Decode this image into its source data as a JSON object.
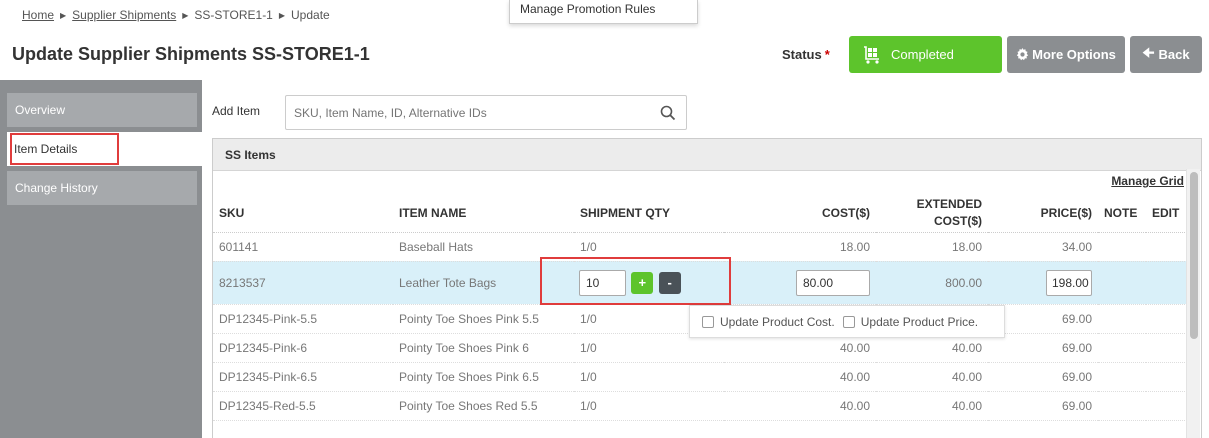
{
  "breadcrumb": {
    "home": "Home",
    "supplier_shipments": "Supplier Shipments",
    "record": "SS-STORE1-1",
    "current": "Update"
  },
  "popup_menu": {
    "item": "Manage Promotion Rules"
  },
  "page": {
    "title": "Update Supplier Shipments SS-STORE1-1"
  },
  "status": {
    "label": "Status",
    "required_mark": "*",
    "value": "Completed",
    "color": "#5dc42c"
  },
  "buttons": {
    "more_options": "More Options",
    "back": "Back"
  },
  "sidebar": {
    "items": [
      {
        "label": "Overview"
      },
      {
        "label": "Item Details"
      },
      {
        "label": "Change History"
      }
    ]
  },
  "add_item": {
    "label": "Add Item",
    "placeholder": "SKU, Item Name, ID, Alternative IDs"
  },
  "panel": {
    "title": "SS Items",
    "manage_grid": "Manage Grid"
  },
  "table": {
    "headers": {
      "sku": "SKU",
      "item_name": "ITEM NAME",
      "shipment_qty": "SHIPMENT QTY",
      "cost": "COST($)",
      "extended_cost_1": "EXTENDED",
      "extended_cost_2": "COST($)",
      "price": "PRICE($)",
      "note": "NOTE",
      "edit": "EDIT"
    },
    "rows": [
      {
        "sku": "601141",
        "name": "Baseball Hats",
        "qty": "1/0",
        "cost": "18.00",
        "ext": "18.00",
        "price": "34.00"
      },
      {
        "sku": "8213537",
        "name": "Leather Tote Bags",
        "qty_input": "10",
        "plus": "+",
        "minus": "-",
        "cost_input": "80.00",
        "ext": "800.00",
        "price_input": "198.00"
      },
      {
        "sku": "DP12345-Pink-5.5",
        "name": "Pointy Toe Shoes Pink 5.5",
        "qty": "1/0",
        "cost": "",
        "ext": "",
        "price": "69.00"
      },
      {
        "sku": "DP12345-Pink-6",
        "name": "Pointy Toe Shoes Pink 6",
        "qty": "1/0",
        "cost": "40.00",
        "ext": "40.00",
        "price": "69.00"
      },
      {
        "sku": "DP12345-Pink-6.5",
        "name": "Pointy Toe Shoes Pink 6.5",
        "qty": "1/0",
        "cost": "40.00",
        "ext": "40.00",
        "price": "69.00"
      },
      {
        "sku": "DP12345-Red-5.5",
        "name": "Pointy Toe Shoes Red 5.5",
        "qty": "1/0",
        "cost": "40.00",
        "ext": "40.00",
        "price": "69.00"
      }
    ]
  },
  "update_popup": {
    "update_cost": "Update Product Cost.",
    "update_price": "Update Product Price."
  }
}
